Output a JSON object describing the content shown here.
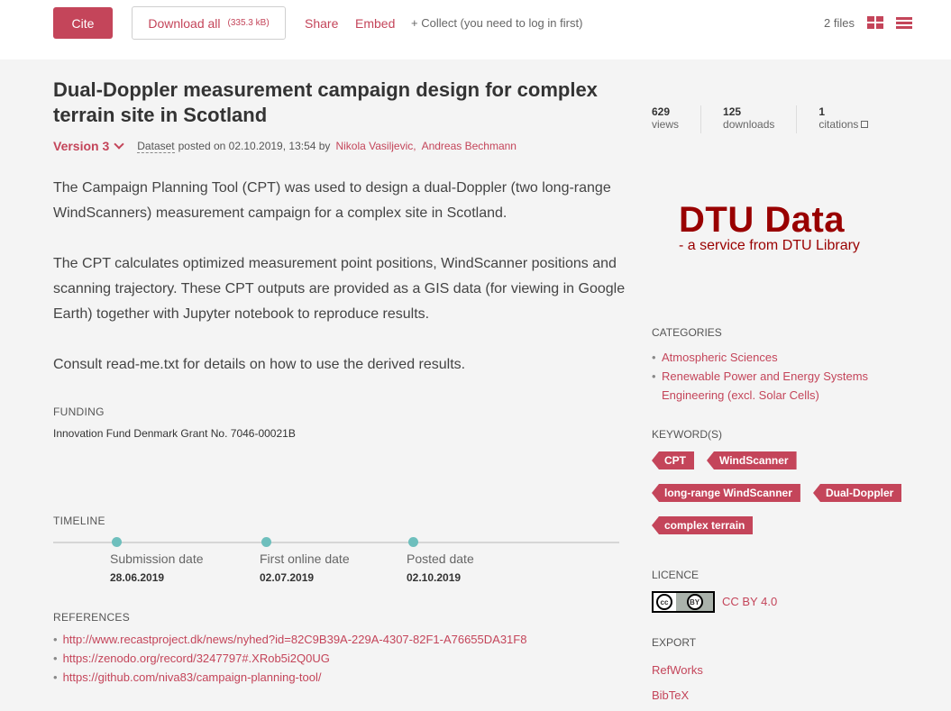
{
  "toolbar": {
    "cite_label": "Cite",
    "download_label": "Download all",
    "download_size": "(335.3 kB)",
    "share_label": "Share",
    "embed_label": "Embed",
    "collect_label": "+ Collect (you need to log in first)",
    "files_count": "2 files"
  },
  "item": {
    "title": "Dual-Doppler measurement campaign design for complex terrain site in Scotland",
    "version": "Version 3",
    "type": "Dataset",
    "posted": "posted on 02.10.2019, 13:54 by",
    "authors": [
      "Nikola Vasiljevic,",
      "Andreas Bechmann"
    ]
  },
  "description": [
    "The Campaign Planning Tool (CPT) was used to design a dual-Doppler (two long-range WindScanners) measurement campaign for a complex site in Scotland.",
    "The CPT calculates optimized measurement point positions, WindScanner positions and scanning trajectory. These CPT outputs are provided as a GIS data (for viewing in Google Earth) together with Jupyter notebook to reproduce results.",
    "Consult read-me.txt for details on how to use the derived results."
  ],
  "funding": {
    "label": "FUNDING",
    "text": "Innovation Fund Denmark Grant No. 7046-00021B"
  },
  "timeline": {
    "label": "TIMELINE",
    "events": [
      {
        "label": "Submission date",
        "date": "28.06.2019"
      },
      {
        "label": "First online date",
        "date": "02.07.2019"
      },
      {
        "label": "Posted date",
        "date": "02.10.2019"
      }
    ]
  },
  "references": {
    "label": "REFERENCES",
    "items": [
      "http://www.recastproject.dk/news/nyhed?id=82C9B39A-229A-4307-82F1-A76655DA31F8",
      "https://zenodo.org/record/3247797#.XRob5i2Q0UG",
      "https://github.com/niva83/campaign-planning-tool/"
    ]
  },
  "stats": {
    "views": {
      "n": "629",
      "l": "views"
    },
    "downloads": {
      "n": "125",
      "l": "downloads"
    },
    "citations": {
      "n": "1",
      "l": "citations"
    }
  },
  "logo": {
    "big": "DTU Data",
    "small": "- a service from DTU Library"
  },
  "categories": {
    "label": "CATEGORIES",
    "items": [
      "Atmospheric Sciences",
      "Renewable Power and Energy Systems Engineering (excl. Solar Cells)"
    ]
  },
  "keywords": {
    "label": "KEYWORD(S)",
    "items": [
      "CPT",
      "WindScanner",
      "long-range WindScanner",
      "Dual-Doppler",
      "complex terrain"
    ]
  },
  "licence": {
    "label": "LICENCE",
    "badge_cc": "cc",
    "badge_by": "BY",
    "text": "CC BY 4.0"
  },
  "export": {
    "label": "EXPORT",
    "items": [
      "RefWorks",
      "BibTeX"
    ]
  },
  "colors": {
    "accent": "#c4455a",
    "timeline_dot": "#6ebfbd",
    "logo": "#990000"
  }
}
